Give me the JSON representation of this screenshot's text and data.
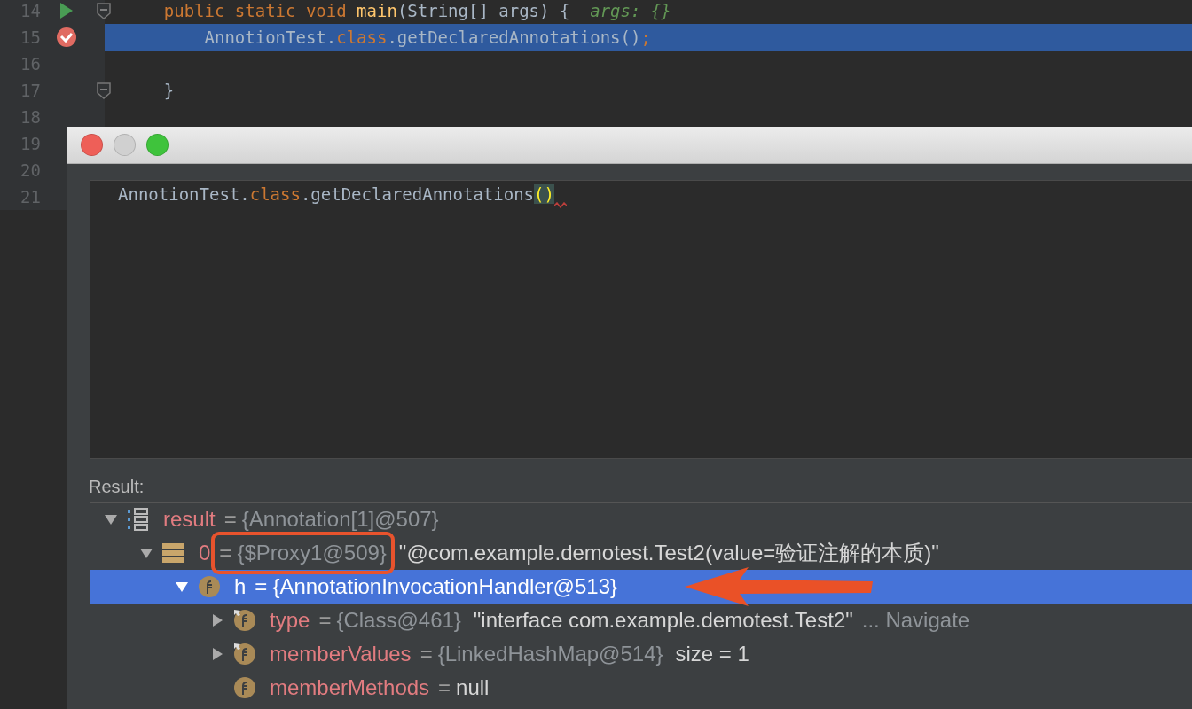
{
  "editor": {
    "lines": [
      {
        "number": "14",
        "kind": "run",
        "fold": true,
        "selected": false,
        "tokens": [
          {
            "text": "    public static void ",
            "kind": "keyword"
          },
          {
            "text": "main",
            "kind": "method"
          },
          {
            "text": "(String[] args) {",
            "kind": "plain"
          },
          {
            "text": "  args: {}",
            "kind": "hint"
          }
        ]
      },
      {
        "number": "15",
        "kind": "breakpoint",
        "selected": true,
        "tokens": [
          {
            "text": "        AnnotionTest.",
            "kind": "plain"
          },
          {
            "text": "class",
            "kind": "keyword"
          },
          {
            "text": ".getDeclaredAnnotations()",
            "kind": "plain"
          },
          {
            "text": ";",
            "kind": "keyword"
          }
        ]
      },
      {
        "number": "16",
        "selected": false
      },
      {
        "number": "17",
        "fold": true,
        "selected": false,
        "tokens": [
          {
            "text": "    }",
            "kind": "plain"
          }
        ]
      },
      {
        "number": "18",
        "selected": false
      },
      {
        "number": "19"
      },
      {
        "number": "20"
      },
      {
        "number": "21"
      }
    ]
  },
  "dialog": {
    "buttons": [
      {
        "kind": "close",
        "disabled": false
      },
      {
        "kind": "minimize",
        "disabled": true
      },
      {
        "kind": "zoom",
        "disabled": false
      }
    ],
    "expression": [
      {
        "text": "AnnotionTest.",
        "kind": "plain"
      },
      {
        "text": "class",
        "kind": "keyword"
      },
      {
        "text": ".getDeclaredAnnotations",
        "kind": "plain"
      },
      {
        "text": "()",
        "kind": "paren"
      }
    ],
    "result_label": "Result:",
    "tree": [
      {
        "kind": "array",
        "name": "result",
        "eq": "=",
        "value": "{Annotation[1]@507}",
        "expanded": true,
        "selected": false,
        "children": [
          {
            "kind": "list",
            "name": "0",
            "eq": "=",
            "value": "{$Proxy1@509}",
            "extra": "\"@com.example.demotest.Test2(value=验证注解的本质)\"",
            "expanded": true,
            "selected": false,
            "children": [
              {
                "kind": "field",
                "name": "h",
                "eq": "=",
                "value": "{AnnotationInvocationHandler@513}",
                "expanded": true,
                "selected": true,
                "children": [
                  {
                    "kind": "field-pinned",
                    "name": "type",
                    "eq": "=",
                    "value": "{Class@461}",
                    "extra": "\"interface com.example.demotest.Test2\"",
                    "action": "... Navigate",
                    "expanded": false,
                    "selected": false
                  },
                  {
                    "kind": "field-pinned",
                    "name": "memberValues",
                    "eq": "=",
                    "value": "{LinkedHashMap@514}",
                    "extra": "size = 1",
                    "expanded": false,
                    "selected": false
                  },
                  {
                    "kind": "field",
                    "name": "memberMethods",
                    "eq": "=",
                    "extra": "null",
                    "selected": false
                  }
                ]
              }
            ]
          }
        ]
      }
    ]
  }
}
